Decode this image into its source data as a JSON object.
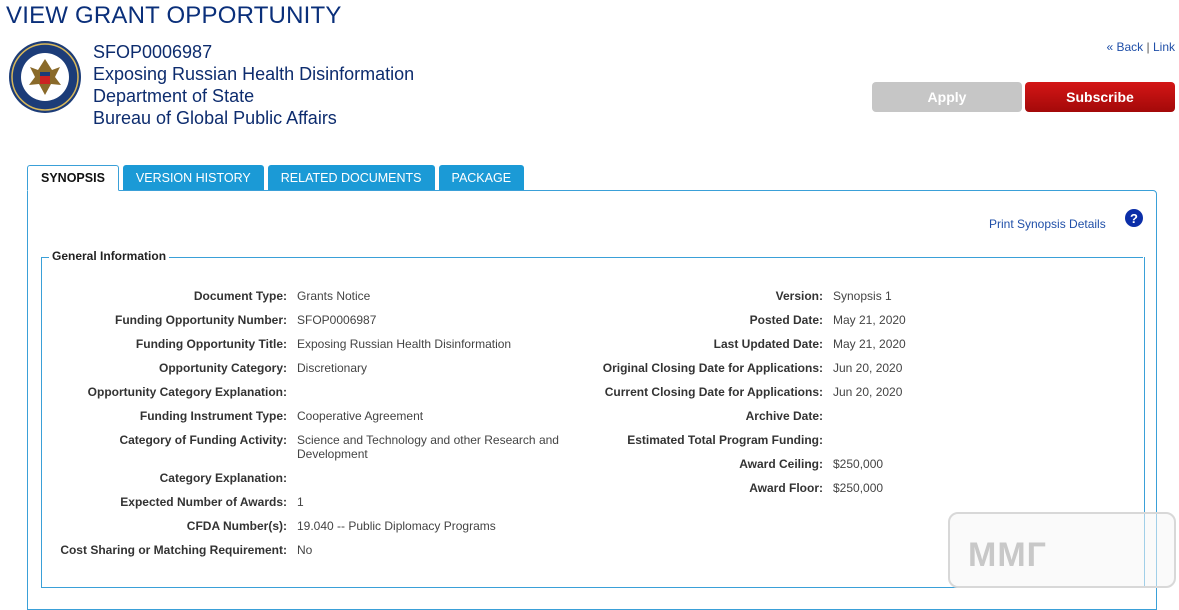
{
  "page_title": "VIEW GRANT OPPORTUNITY",
  "header": {
    "id": "SFOP0006987",
    "title": "Exposing Russian Health Disinformation",
    "agency": "Department of State",
    "bureau": "Bureau of Global Public Affairs",
    "seal_icon": "department-of-state-seal"
  },
  "links": {
    "back": "« Back",
    "separator": "|",
    "link": "Link"
  },
  "buttons": {
    "apply": "Apply",
    "subscribe": "Subscribe"
  },
  "tabs": [
    "SYNOPSIS",
    "VERSION HISTORY",
    "RELATED DOCUMENTS",
    "PACKAGE"
  ],
  "print_link": "Print Synopsis Details",
  "help_icon": "?",
  "section_title": "General Information",
  "left_fields": [
    {
      "label": "Document Type:",
      "value": "Grants Notice"
    },
    {
      "label": "Funding Opportunity Number:",
      "value": "SFOP0006987"
    },
    {
      "label": "Funding Opportunity Title:",
      "value": "Exposing Russian Health Disinformation"
    },
    {
      "label": "Opportunity Category:",
      "value": "Discretionary"
    },
    {
      "label": "Opportunity Category Explanation:",
      "value": ""
    },
    {
      "label": "Funding Instrument Type:",
      "value": "Cooperative Agreement"
    },
    {
      "label": "Category of Funding Activity:",
      "value": "Science and Technology and other Research and Development"
    },
    {
      "label": "Category Explanation:",
      "value": ""
    },
    {
      "label": "Expected Number of Awards:",
      "value": "1"
    },
    {
      "label": "CFDA Number(s):",
      "value": "19.040 -- Public Diplomacy Programs"
    },
    {
      "label": "Cost Sharing or Matching Requirement:",
      "value": "No"
    }
  ],
  "right_fields": [
    {
      "label": "Version:",
      "value": "Synopsis 1"
    },
    {
      "label": "Posted Date:",
      "value": "May 21, 2020"
    },
    {
      "label": "Last Updated Date:",
      "value": "May 21, 2020"
    },
    {
      "label": "Original Closing Date for Applications:",
      "value": "Jun 20, 2020"
    },
    {
      "label": "Current Closing Date for Applications:",
      "value": "Jun 20, 2020"
    },
    {
      "label": "Archive Date:",
      "value": ""
    },
    {
      "label": "Estimated Total Program Funding:",
      "value": ""
    },
    {
      "label": "Award Ceiling:",
      "value": "$250,000"
    },
    {
      "label": "Award Floor:",
      "value": "$250,000"
    }
  ],
  "watermark": "ММГ",
  "colors": {
    "title": "#0a2f7a",
    "tab": "#1b9ad6",
    "subscribe": "#c01010",
    "apply": "#c6c6c6"
  }
}
